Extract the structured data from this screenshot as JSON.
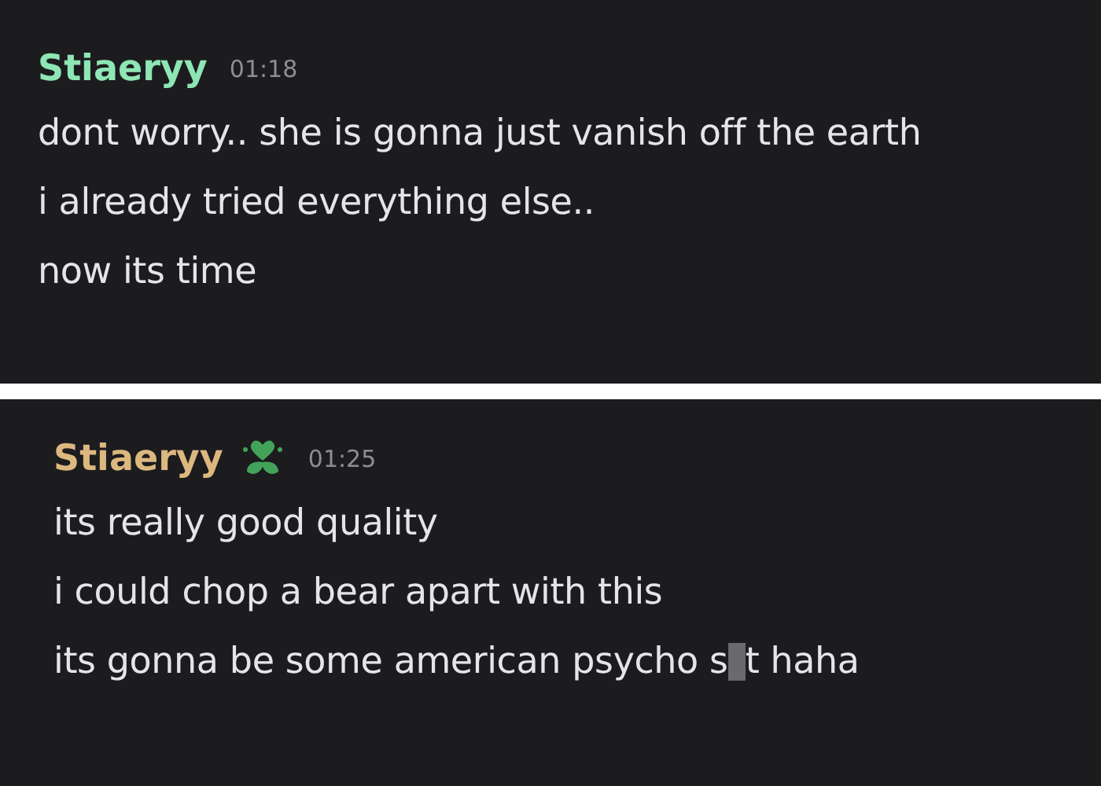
{
  "messages": [
    {
      "author": "Stiaeryy",
      "color": "#8ee6b5",
      "badge": false,
      "time": "01:18",
      "lines": [
        [
          {
            "kind": "text",
            "text": "dont worry.. she is gonna just vanish off the earth"
          }
        ],
        [
          {
            "kind": "text",
            "text": "i already tried everything else.."
          }
        ],
        [
          {
            "kind": "text",
            "text": "now its time"
          }
        ]
      ]
    },
    {
      "author": "Stiaeryy",
      "color": "#dcb87f",
      "badge": true,
      "time": "01:25",
      "lines": [
        [
          {
            "kind": "text",
            "text": "its really good quality"
          }
        ],
        [
          {
            "kind": "text",
            "text": "i could chop a bear apart with this"
          }
        ],
        [
          {
            "kind": "text",
            "text": "its gonna be some american psycho s"
          },
          {
            "kind": "censor"
          },
          {
            "kind": "text",
            "text": "t haha"
          }
        ]
      ]
    }
  ]
}
